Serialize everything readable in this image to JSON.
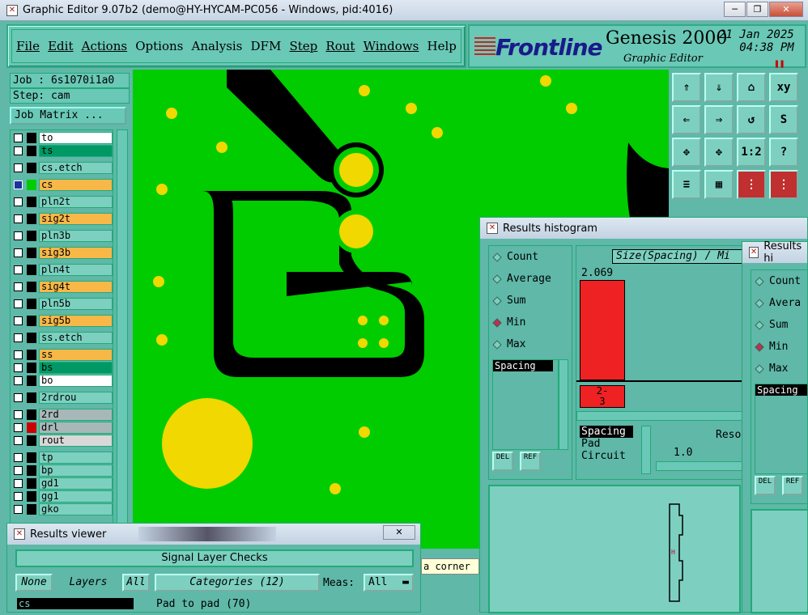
{
  "window": {
    "title": "Graphic Editor 9.07b2 (demo@HY-HYCAM-PC056 - Windows, pid:4016)",
    "min": "─",
    "max": "❐",
    "close": "✕"
  },
  "menu": [
    "File",
    "Edit",
    "Actions",
    "Options",
    "Analysis",
    "DFM",
    "Step",
    "Rout",
    "Windows",
    "Help"
  ],
  "brand": {
    "logo": "Frontline",
    "product": "Genesis 2000",
    "subtitle": "Graphic Editor",
    "date": "21 Jan 2025",
    "time": "04:38 PM",
    "pause": "❚❚"
  },
  "job": {
    "job_label": "Job : 6s1070i1a0",
    "step_label": "Step: cam",
    "matrix_btn": "Job Matrix ..."
  },
  "layers": [
    {
      "name": "to",
      "bg": "#ffffff",
      "sw": "#000000"
    },
    {
      "name": "ts",
      "bg": "#009966",
      "sw": "#000000"
    },
    {
      "name": "cs.etch",
      "bg": "#7dd0c0",
      "sw": "#000000"
    },
    {
      "name": "cs",
      "bg": "#f8b848",
      "sw": "#00cc00",
      "active": true
    },
    {
      "name": "pln2t",
      "bg": "#7dd0c0",
      "sw": "#000000"
    },
    {
      "name": "sig2t",
      "bg": "#f8b848",
      "sw": "#000000"
    },
    {
      "name": "pln3b",
      "bg": "#7dd0c0",
      "sw": "#000000"
    },
    {
      "name": "sig3b",
      "bg": "#f8b848",
      "sw": "#000000"
    },
    {
      "name": "pln4t",
      "bg": "#7dd0c0",
      "sw": "#000000"
    },
    {
      "name": "sig4t",
      "bg": "#f8b848",
      "sw": "#000000"
    },
    {
      "name": "pln5b",
      "bg": "#7dd0c0",
      "sw": "#000000"
    },
    {
      "name": "sig5b",
      "bg": "#f8b848",
      "sw": "#000000"
    },
    {
      "name": "ss.etch",
      "bg": "#7dd0c0",
      "sw": "#000000"
    },
    {
      "name": "ss",
      "bg": "#f8b848",
      "sw": "#000000"
    },
    {
      "name": "bs",
      "bg": "#009966",
      "sw": "#000000"
    },
    {
      "name": "bo",
      "bg": "#ffffff",
      "sw": "#000000"
    },
    {
      "name": "2rdrou",
      "bg": "#7dd0c0",
      "sw": "#000000"
    },
    {
      "name": "2rd",
      "bg": "#a8b8b8",
      "sw": "#000000"
    },
    {
      "name": "drl",
      "bg": "#a8b8b8",
      "sw": "#cc0000"
    },
    {
      "name": "rout",
      "bg": "#d8d8d8",
      "sw": "#000000"
    },
    {
      "name": "tp",
      "bg": "#7dd0c0",
      "sw": "#000000"
    },
    {
      "name": "bp",
      "bg": "#7dd0c0",
      "sw": "#000000"
    },
    {
      "name": "gd1",
      "bg": "#7dd0c0",
      "sw": "#000000"
    },
    {
      "name": "gg1",
      "bg": "#7dd0c0",
      "sw": "#000000"
    },
    {
      "name": "gko",
      "bg": "#7dd0c0",
      "sw": "#000000"
    }
  ],
  "tools": [
    "⇑",
    "⇓",
    "⌂",
    "xy",
    "⇐",
    "⇒",
    "↺",
    "S",
    "✥",
    "✥",
    "1:2",
    "?",
    "≡",
    "▦",
    "⋮",
    "⋮"
  ],
  "histogram": {
    "title": "Results histogram",
    "options": [
      "Count",
      "Average",
      "Sum",
      "Min",
      "Max"
    ],
    "selected": "Min",
    "header": "Size(Spacing) / Mi",
    "value": "2.069",
    "bin": "2-\n3",
    "list_item": "Spacing",
    "categories": [
      "Spacing",
      "Pad",
      "Circuit"
    ],
    "reso_label": "Reso",
    "reso_value": "1.0",
    "del": "DEL",
    "ref": "REF"
  },
  "histogram2": {
    "title": "Results hi",
    "options": [
      "Count",
      "Avera",
      "Sum",
      "Min",
      "Max"
    ],
    "selected": "Min",
    "list_item": "Spacing",
    "del": "DEL",
    "ref": "REF"
  },
  "viewer": {
    "title": "Results viewer",
    "header": "Signal Layer Checks",
    "none": "None",
    "layers": "Layers",
    "all": "All",
    "categories": "Categories (12)",
    "meas": "Meas:",
    "meas_value": "All",
    "layer_item": "cs",
    "category_item": "Pad to pad (70)",
    "close": "✕"
  },
  "status": {
    "message": "a corner"
  }
}
